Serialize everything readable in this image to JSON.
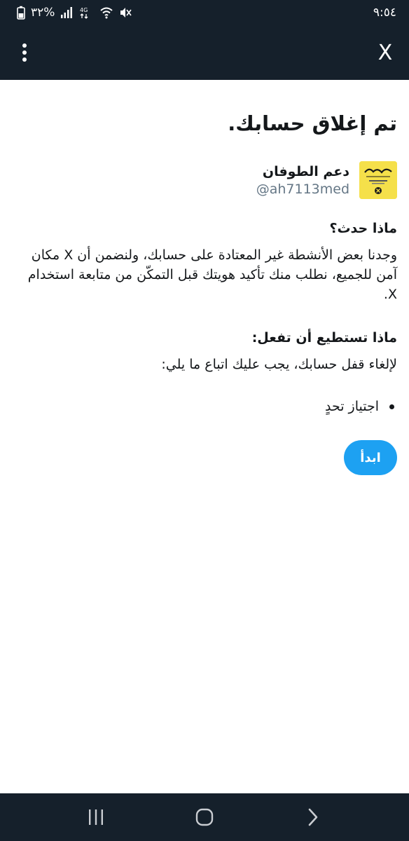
{
  "status_bar": {
    "time": "٩:٥٤",
    "battery": "٣٢%"
  },
  "app_bar": {
    "close_label": "X"
  },
  "page": {
    "title": "تم إغلاق حسابك.",
    "account": {
      "name": "دعم الطوفان",
      "handle": "@ah7113med"
    },
    "what_happened": {
      "heading": "ماذا حدث؟",
      "text": "وجدنا بعض الأنشطة غير المعتادة على حسابك، ولنضمن أن X مكان آمن للجميع، نطلب منك تأكيد هويتك قبل التمكّن من متابعة استخدام X."
    },
    "what_to_do": {
      "heading": "ماذا تستطيع أن تفعل:",
      "text": "لإلغاء قفل حسابك، يجب عليك اتباع ما يلي:",
      "steps": [
        "اجتياز تحدٍ"
      ]
    },
    "start_button": "ابدأ"
  },
  "colors": {
    "header_bg": "#15202b",
    "accent": "#1da1f2",
    "avatar_bg": "#f5e04a",
    "secondary_text": "#657786"
  },
  "icons": {
    "menu": "more-vertical-icon",
    "recents": "recent-apps-icon",
    "home": "home-icon",
    "back": "back-icon"
  }
}
